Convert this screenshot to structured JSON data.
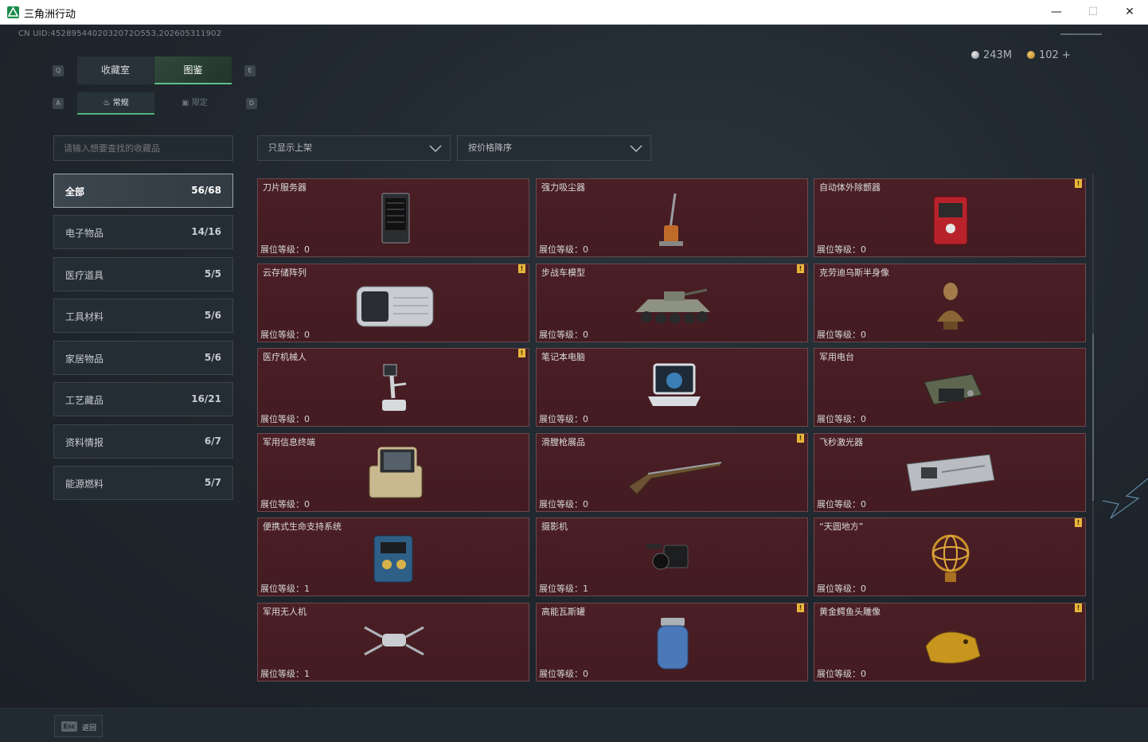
{
  "window": {
    "title": "三角洲行动",
    "minimize": "—",
    "maximize": "☐",
    "close": "✕"
  },
  "header": {
    "uid": "CN UID:4528954402032072O553,202605311902",
    "currency_silver": "243M",
    "currency_gold": "102 +"
  },
  "keyhints": {
    "left_main": "Q",
    "right_main": "E",
    "left_sub": "A",
    "right_sub": "D"
  },
  "tabs": [
    {
      "label": "收藏室"
    },
    {
      "label": "图鉴"
    }
  ],
  "subtabs": [
    {
      "label": "常规"
    },
    {
      "label": "限定"
    }
  ],
  "search": {
    "placeholder": "请输入想要查找的收藏品"
  },
  "filters": {
    "shelf": "只显示上架",
    "sort": "按价格降序"
  },
  "categories": [
    {
      "label": "全部",
      "count": "56/68"
    },
    {
      "label": "电子物品",
      "count": "14/16"
    },
    {
      "label": "医疗道具",
      "count": "5/5"
    },
    {
      "label": "工具材料",
      "count": "5/6"
    },
    {
      "label": "家居物品",
      "count": "5/6"
    },
    {
      "label": "工艺藏品",
      "count": "16/21"
    },
    {
      "label": "资料情报",
      "count": "6/7"
    },
    {
      "label": "能源燃料",
      "count": "5/7"
    }
  ],
  "items": [
    {
      "name": "刀片服务器",
      "level": "展位等级：0",
      "badge": ""
    },
    {
      "name": "强力吸尘器",
      "level": "展位等级：0",
      "badge": ""
    },
    {
      "name": "自动体外除颤器",
      "level": "展位等级：0",
      "badge": "!"
    },
    {
      "name": "云存储阵列",
      "level": "展位等级：0",
      "badge": "!"
    },
    {
      "name": "步战车模型",
      "level": "展位等级：0",
      "badge": "!"
    },
    {
      "name": "克劳迪乌斯半身像",
      "level": "展位等级：0",
      "badge": ""
    },
    {
      "name": "医疗机械人",
      "level": "展位等级：0",
      "badge": "!"
    },
    {
      "name": "笔记本电脑",
      "level": "展位等级：0",
      "badge": ""
    },
    {
      "name": "军用电台",
      "level": "展位等级：0",
      "badge": ""
    },
    {
      "name": "军用信息终端",
      "level": "展位等级：0",
      "badge": ""
    },
    {
      "name": "滑膛枪展品",
      "level": "展位等级：0",
      "badge": "!"
    },
    {
      "name": "飞秒激光器",
      "level": "展位等级：0",
      "badge": ""
    },
    {
      "name": "便携式生命支持系统",
      "level": "展位等级：1",
      "badge": ""
    },
    {
      "name": "摄影机",
      "level": "展位等级：1",
      "badge": ""
    },
    {
      "name": "“天圆地方”",
      "level": "展位等级：0",
      "badge": "!"
    },
    {
      "name": "军用无人机",
      "level": "展位等级：1",
      "badge": ""
    },
    {
      "name": "高能瓦斯罐",
      "level": "展位等级：0",
      "badge": "!"
    },
    {
      "name": "黄金鳄鱼头雕像",
      "level": "展位等级：0",
      "badge": "!"
    }
  ],
  "footer": {
    "esc_key": "Esc",
    "esc_label": "返回"
  }
}
